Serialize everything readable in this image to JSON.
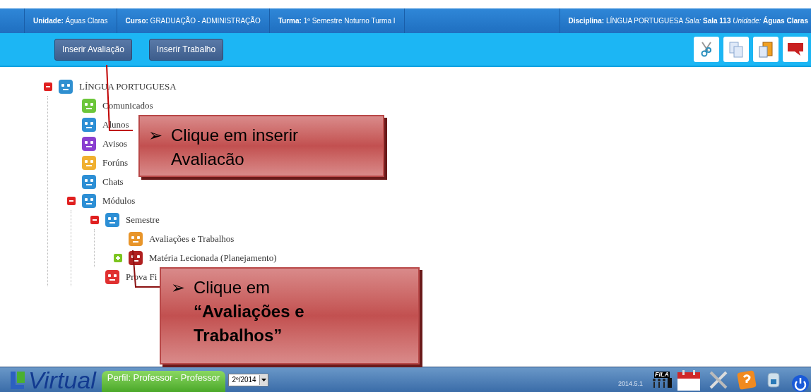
{
  "header": {
    "fields": [
      {
        "label": "Unidade:",
        "value": "Águas Claras"
      },
      {
        "label": "Curso:",
        "value": "GRADUAÇÃO - ADMINISTRAÇÃO"
      },
      {
        "label": "Turma:",
        "value": "1º Semestre Noturno Turma I"
      }
    ],
    "right": "**Disciplina:** LÍNGUA PORTUGUESA *Sala:* **Sala 113** *Unidade:* **Águas Claras**"
  },
  "toolbar": {
    "buttons": [
      "Inserir Avaliação",
      "Inserir Trabalho"
    ]
  },
  "tree": [
    {
      "label": "LÍNGUA PORTUGUESA",
      "kind": "discipline",
      "expanded": true,
      "children": [
        {
          "label": "Comunicados",
          "kind": "green"
        },
        {
          "label": "Alunos",
          "kind": "blue"
        },
        {
          "label": "Avisos",
          "kind": "purple"
        },
        {
          "label": "Forúns",
          "kind": "multi"
        },
        {
          "label": "Chats",
          "kind": "blue"
        },
        {
          "label": "Módulos",
          "kind": "blue",
          "expanded": true,
          "children": [
            {
              "label": "Semestre",
              "kind": "blue",
              "expanded": true,
              "children": [
                {
                  "label": "Avaliações e Trabalhos",
                  "kind": "orange"
                },
                {
                  "label": "Matéria Lecionada (Planejamento)",
                  "kind": "red",
                  "expanded": false
                }
              ]
            },
            {
              "label": "Prova Fi",
              "kind": "heart"
            }
          ]
        }
      ]
    }
  ],
  "callouts": [
    {
      "marker": "➢",
      "text": "Clique em inserir Avaliacão"
    },
    {
      "marker": "➢",
      "text": "Clique em **“Avaliações e Trabalhos”**"
    }
  ],
  "footer": {
    "logo": "Virtual",
    "profile": "Perfil: Professor - Professor",
    "period": "2º/2014",
    "version": "2014.5.1",
    "queue_label": "FILA"
  }
}
